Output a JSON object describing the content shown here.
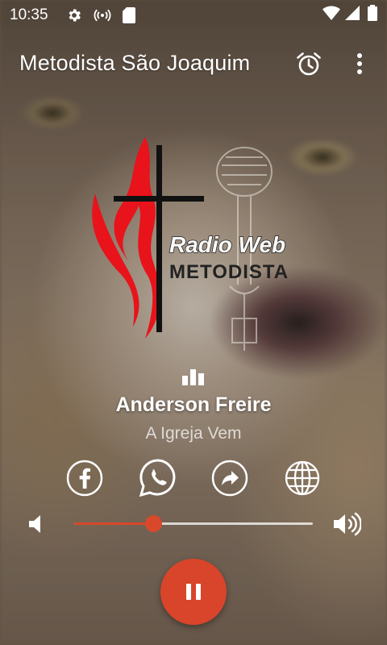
{
  "status_bar": {
    "time": "10:35",
    "icons": [
      "gear-icon",
      "broadcast-icon",
      "sd-card-icon",
      "wifi-icon",
      "signal-icon",
      "battery-icon"
    ]
  },
  "app_bar": {
    "title": "Metodista São Joaquim",
    "actions": [
      "alarm-icon",
      "more-vert-icon"
    ]
  },
  "logo": {
    "line1": "Radio Web",
    "line2": "Metodista"
  },
  "now_playing": {
    "artist": "Anderson Freire",
    "song": "A Igreja Vem"
  },
  "share": {
    "buttons": [
      "facebook-icon",
      "whatsapp-icon",
      "share-icon",
      "globe-icon"
    ]
  },
  "volume": {
    "level": 0.33
  },
  "colors": {
    "accent": "#d8452a",
    "logo_red": "#e8131b",
    "logo_black": "#111111"
  },
  "player": {
    "state": "playing",
    "control_icon": "pause-icon"
  }
}
